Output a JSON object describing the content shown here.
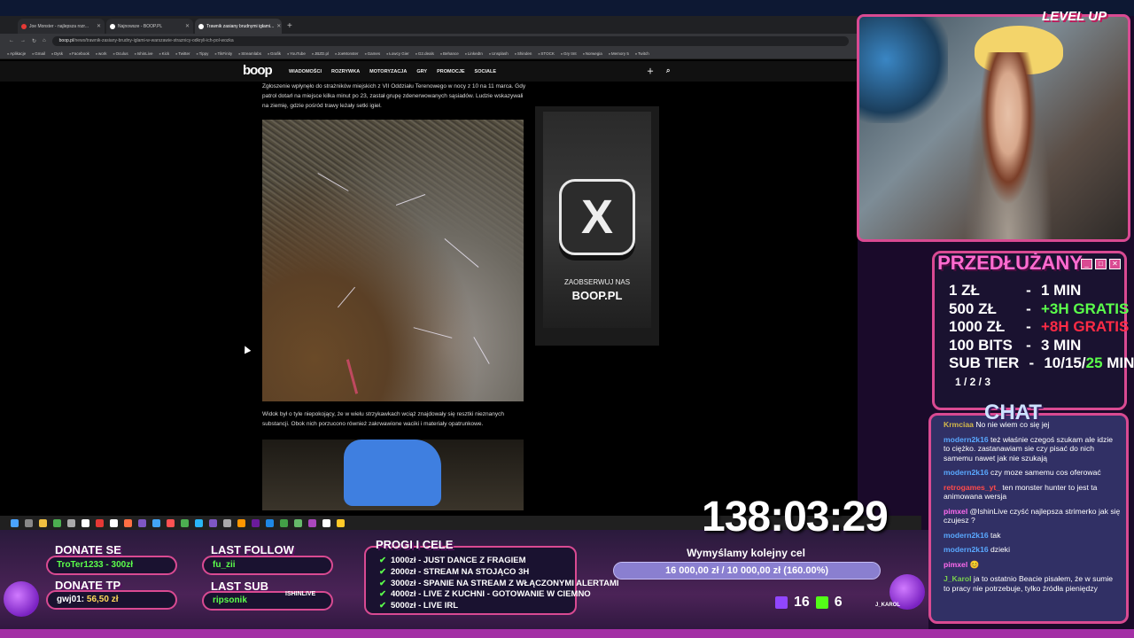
{
  "browser": {
    "tabs": [
      {
        "title": "Joe Monster - najlepsza rozr...",
        "active": false
      },
      {
        "title": "Najnowsze - BOOP.PL",
        "active": false
      },
      {
        "title": "Trawnik zasiany brudnymi igłami...",
        "active": true
      }
    ],
    "url_domain": "boop.pl",
    "url_path": "/news/trawnik-zasiany-brudny-iglami-w-warszawie-straznicy-odkryli-ich-pol-wozka",
    "bookmarks": [
      "Aplikacje",
      "Gmail",
      "Dysk",
      "Facebook",
      "work",
      "Oculus",
      "IshinLive",
      "Kick",
      "Twitter",
      "Tippy",
      "TikFinity",
      "Streamlabs",
      "Grafik",
      "YouTube",
      "JBZD.pl",
      "JoeMonster",
      "Games",
      "Łowcy Gier",
      "G2.deals",
      "Behance",
      "LinkedIn",
      "Unsplash",
      "Shinden",
      "STOCK",
      "Gry tmt",
      "Norwegia",
      "Memory 5",
      "Twitch"
    ]
  },
  "site": {
    "logo": "boop",
    "nav": [
      "WIADOMOŚCI",
      "ROZRYWKA",
      "MOTORYZACJA",
      "GRY",
      "PROMOCJE",
      "SOCIALE"
    ],
    "icons": [
      "plus-icon",
      "search-icon"
    ]
  },
  "article": {
    "para1": "Zgłoszenie wpłynęło do strażników miejskich z VII Oddziału Terenowego w nocy z 10 na 11 marca. Gdy patrol dotarł na miejsce kilka minut po 23, zastał grupę zdenerwowanych sąsiadów. Ludzie wskazywali na ziemię, gdzie pośród trawy leżały setki igieł.",
    "para2": "Widok był o tyle niepokojący, że w wielu strzykawkach wciąż znajdowały się resztki nieznanych substancji. Obok nich porzucono również zakrwawione waciki i materiały opatrunkowe."
  },
  "ad": {
    "brand_glyph": "X",
    "small": "ZAOBSERWUJ NAS",
    "big": "BOOP.PL"
  },
  "overlay": {
    "levelup": "LEVEL UP",
    "timer": "138:03:29",
    "donate_panel": {
      "title": "PRZEDŁUŻANY",
      "rows": [
        {
          "amount": "1 ZŁ",
          "sep": "-",
          "reward": "1 MIN",
          "color": "white"
        },
        {
          "amount": "500 ZŁ",
          "sep": "-",
          "reward": "+3H GRATIS",
          "color": "green"
        },
        {
          "amount": "1000 ZŁ",
          "sep": "-",
          "reward": "+8H GRATIS",
          "color": "red"
        },
        {
          "amount": "100 BITS",
          "sep": "-",
          "reward": "3 MIN",
          "color": "white"
        }
      ],
      "sub_tier": "SUB TIER",
      "sub_split": "1 / 2 / 3",
      "sub_reward_a": "10/15/",
      "sub_reward_b": "25",
      "sub_reward_c": " MIN"
    },
    "chat_title": "CHAT",
    "chat": [
      {
        "user": "Krmciaa",
        "text": "No nie wiem co się jej",
        "cls": "y"
      },
      {
        "user": "modern2k16",
        "text": "też właśnie czegoś szukam ale idzie to ciężko. zastanawiam sie czy pisać do nich samemu nawet jak nie szukają",
        "cls": ""
      },
      {
        "user": "modern2k16",
        "text": "czy moze samemu cos oferować",
        "cls": ""
      },
      {
        "user": "retrogames_yt_",
        "text": "ten monster hunter to jest ta animowana wersja",
        "cls": "r"
      },
      {
        "user": "pimxel",
        "text": "@IshinLive czyść najlepsza strimerko jak się czujesz ?",
        "cls": "p"
      },
      {
        "user": "modern2k16",
        "text": "tak",
        "cls": ""
      },
      {
        "user": "modern2k16",
        "text": "dzieki",
        "cls": ""
      },
      {
        "user": "pimxel",
        "text": "😊",
        "cls": "p"
      },
      {
        "user": "J_Karol",
        "text": "ja to ostatnio Beacie pisałem, że w sumie to pracy nie potrzebuje, tylko źródła pieniędzy",
        "cls": "g"
      }
    ],
    "donate_se_label": "DONATE SE",
    "donate_se_value": "TroTer1233 - 300zł",
    "donate_tp_label": "DONATE TP",
    "donate_tp_user": "gwj01: ",
    "donate_tp_amount": "56,50 zł",
    "last_follow_label": "LAST FOLLOW",
    "last_follow_value": "fu_zii",
    "last_sub_label": "LAST SUB",
    "last_sub_value": "ripsonik",
    "streamer_name": "ISHINLIVE",
    "tiers_title": "PROGI I CELE",
    "tiers": [
      "1000zł - JUST DANCE Z FRAGIEM",
      "2000zł - STREAM NA STOJĄCO 3H",
      "3000zł - SPANIE NA STREAM Z WŁĄCZONYMI ALERTAMI",
      "4000zł - LIVE Z KUCHNI - GOTOWANIE W CIEMNO",
      "5000zł - LIVE IRL"
    ],
    "goal_title": "Wymyślamy kolejny cel",
    "goal_text": "16 000,00 zł / 10 000,00 zł (160.00%)",
    "goal_progress": 1.0,
    "twitch_count": "16",
    "kick_count": "6",
    "jkarol": "J_KAROL"
  }
}
